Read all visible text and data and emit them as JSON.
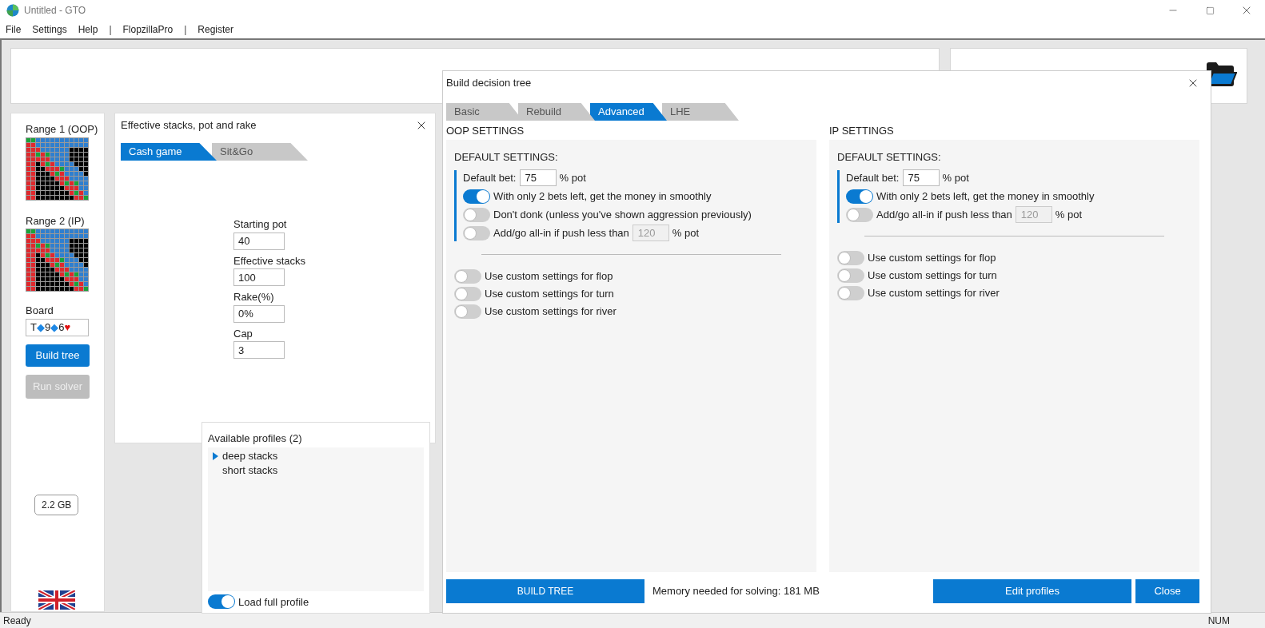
{
  "window": {
    "title": "Untitled - GTO"
  },
  "menu": [
    {
      "label": "File",
      "kind": "item"
    },
    {
      "label": "Settings",
      "kind": "item"
    },
    {
      "label": "Help",
      "kind": "item"
    },
    {
      "label": "|",
      "kind": "separator"
    },
    {
      "label": "FlopzillaPro",
      "kind": "item"
    },
    {
      "label": "|",
      "kind": "separator"
    },
    {
      "label": "Register",
      "kind": "item"
    }
  ],
  "sidebar": {
    "range1_label": "Range 1 (OOP)",
    "range2_label": "Range 2 (IP)",
    "board_label": "Board",
    "board_cards": [
      {
        "rank": "T",
        "suit": "◆",
        "color": "#1e88e5"
      },
      {
        "rank": "9",
        "suit": "◆",
        "color": "#1e88e5"
      },
      {
        "rank": "6",
        "suit": "♥",
        "color": "#e01010"
      }
    ],
    "build_button": {
      "label": "Build tree",
      "disabled": false
    },
    "run_button": {
      "label": "Run solver",
      "disabled": true
    },
    "memory_badge": "2.2 GB"
  },
  "stacks_panel": {
    "title": "Effective stacks, pot and rake",
    "tabs": [
      {
        "label": "Cash game",
        "selected": true
      },
      {
        "label": "Sit&Go",
        "selected": false
      }
    ],
    "fields": [
      {
        "label": "Starting pot",
        "value": "40"
      },
      {
        "label": "Effective stacks",
        "value": "100"
      },
      {
        "label": "Rake(%)",
        "value": "0%"
      },
      {
        "label": "Cap",
        "value": "3"
      }
    ]
  },
  "profiles": {
    "title": "Available profiles (2)",
    "items": [
      {
        "label": "deep stacks",
        "selected": true
      },
      {
        "label": "short stacks",
        "selected": false
      }
    ],
    "load_full": {
      "label": "Load full profile",
      "on": true
    }
  },
  "dialog": {
    "title": "Build decision tree",
    "tabs": [
      {
        "label": "Basic",
        "selected": false
      },
      {
        "label": "Rebuild",
        "selected": false
      },
      {
        "label": "Advanced",
        "selected": true
      },
      {
        "label": "LHE",
        "selected": false
      }
    ],
    "columns": [
      {
        "heading": "OOP SETTINGS",
        "section_title": "DEFAULT SETTINGS:",
        "defaults": [
          {
            "kind": "bet",
            "label": "Default bet:",
            "value": "75",
            "unit": "% pot"
          },
          {
            "kind": "toggle",
            "label": "With only 2 bets left, get the money in smoothly",
            "on": true
          },
          {
            "kind": "toggle",
            "label": "Don't donk (unless you've shown aggression previously)",
            "on": false
          },
          {
            "kind": "toggle_input",
            "label": "Add/go all-in if push less than",
            "on": false,
            "value": "120",
            "disabled": true,
            "unit": "% pot"
          }
        ],
        "custom": [
          {
            "label": "Use custom settings for flop",
            "on": false
          },
          {
            "label": "Use custom settings for turn",
            "on": false
          },
          {
            "label": "Use custom settings for river",
            "on": false
          }
        ]
      },
      {
        "heading": "IP SETTINGS",
        "section_title": "DEFAULT SETTINGS:",
        "defaults": [
          {
            "kind": "bet",
            "label": "Default bet:",
            "value": "75",
            "unit": "% pot"
          },
          {
            "kind": "toggle",
            "label": "With only 2 bets left, get the money in smoothly",
            "on": true
          },
          {
            "kind": "toggle_input",
            "label": "Add/go all-in if push less than",
            "on": false,
            "value": "120",
            "disabled": true,
            "unit": "% pot"
          }
        ],
        "custom": [
          {
            "label": "Use custom settings for flop",
            "on": false
          },
          {
            "label": "Use custom settings for turn",
            "on": false
          },
          {
            "label": "Use custom settings for river",
            "on": false
          }
        ]
      }
    ],
    "build_button": "BUILD TREE",
    "memory_text": "Memory needed for solving: 181 MB",
    "edit_button": "Edit profiles",
    "close_button": "Close"
  },
  "status_bar": {
    "left": "Ready",
    "right": "NUM"
  }
}
